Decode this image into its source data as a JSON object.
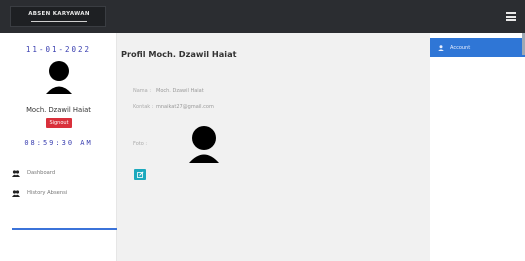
{
  "header": {
    "brand": "ABSEN KARYAWAN"
  },
  "sidebar": {
    "date": "11-01-2022",
    "user_name": "Moch. Dzawil Haiat",
    "signout_label": "Signout",
    "clock": "08:59:30 AM",
    "items": [
      {
        "label": "Dashboard",
        "icon": "users-icon"
      },
      {
        "label": "History Absensi",
        "icon": "users-icon"
      }
    ]
  },
  "main": {
    "title": "Profil Moch. Dzawil Haiat",
    "fields": [
      {
        "label": "Nama :",
        "value": "Moch. Dzawil Haiat"
      },
      {
        "label": "Kontak :",
        "value": "mnaikat27@gmail.com"
      }
    ],
    "photo_label": "Foto :"
  },
  "right_panel": {
    "active_item": "Account"
  },
  "colors": {
    "topbar": "#2b2d31",
    "accent_blue": "#2f76d6",
    "signout_red": "#d9303b",
    "edit_teal": "#1ba9bd",
    "clock_blue": "#3a3fb0"
  }
}
